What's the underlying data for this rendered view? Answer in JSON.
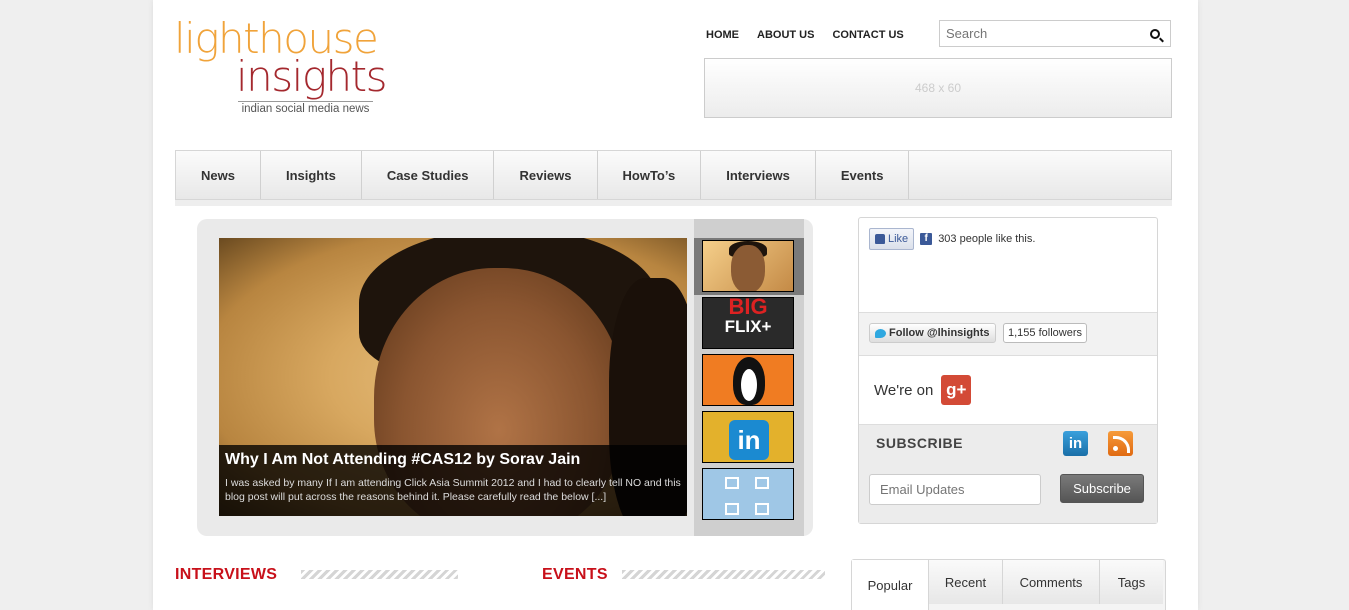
{
  "logo": {
    "line1": "lighthouse",
    "line2": "insights",
    "tagline": "indian social media news"
  },
  "topnav": [
    "HOME",
    "ABOUT US",
    "CONTACT US"
  ],
  "search": {
    "placeholder": "Search"
  },
  "ad": {
    "label": "468 x 60"
  },
  "mainnav": [
    "News",
    "Insights",
    "Case Studies",
    "Reviews",
    "HowTo’s",
    "Interviews",
    "Events"
  ],
  "slider": {
    "title": "Why I Am Not Attending #CAS12 by Sorav Jain",
    "excerpt": "I was asked by many If I am attending Click Asia Summit 2012 and I had to clearly tell NO and this blog post will put across the reasons behind it. Please carefully read the below [...]",
    "thumbs": [
      {
        "name": "sorav-jain-thumb"
      },
      {
        "name": "bigflix-thumb",
        "text_top": "BIG",
        "text_bottom": "FLIX+"
      },
      {
        "name": "penguin-thumb"
      },
      {
        "name": "linkedin-grad-thumb",
        "text": "in"
      },
      {
        "name": "icons-grid-thumb"
      }
    ]
  },
  "sections": {
    "interviews": "INTERVIEWS",
    "events": "EVENTS"
  },
  "sidebar": {
    "facebook": {
      "like_label": "Like",
      "count_text": "303 people like this."
    },
    "twitter": {
      "follow_label": "Follow @lhinsights",
      "followers": "1,155 followers"
    },
    "gplus": {
      "text": "We're on",
      "icon_text": "g+"
    },
    "subscribe": {
      "title": "SUBSCRIBE",
      "email_placeholder": "Email Updates",
      "button": "Subscribe",
      "linkedin_text": "in"
    }
  },
  "tabs": [
    "Popular",
    "Recent",
    "Comments",
    "Tags"
  ],
  "colors": {
    "logo_orange": "#f0a33a",
    "logo_red": "#a4282e",
    "section_red": "#c8101a",
    "facebook_blue": "#3b5998",
    "gplus_red": "#d34a36"
  }
}
